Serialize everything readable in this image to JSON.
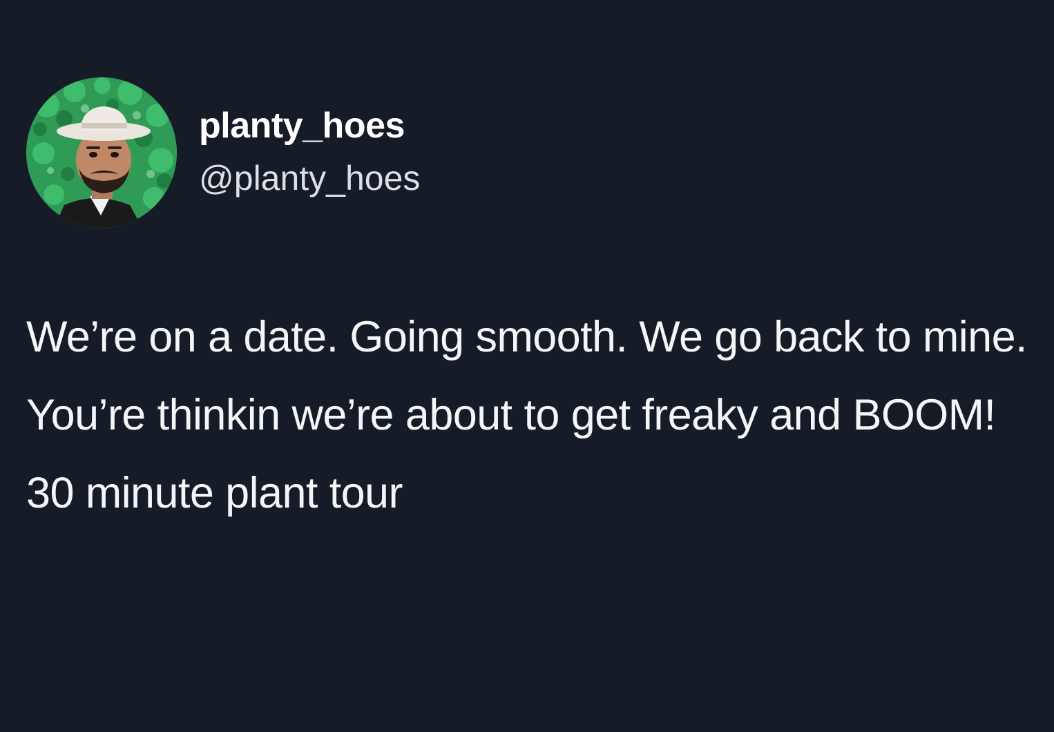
{
  "tweet": {
    "display_name": "planty_hoes",
    "handle": "@planty_hoes",
    "text": "We’re on a date. Going smooth. We go back to mine. You’re thinkin we’re about to get freaky and BOOM! 30 minute plant tour"
  },
  "avatar": {
    "icon": "profile-photo-man-in-hat-with-plants"
  },
  "colors": {
    "background": "#161c27",
    "text": "#ffffff",
    "handle": "#dcdfe4",
    "avatar_bg": "#2e9a55"
  }
}
